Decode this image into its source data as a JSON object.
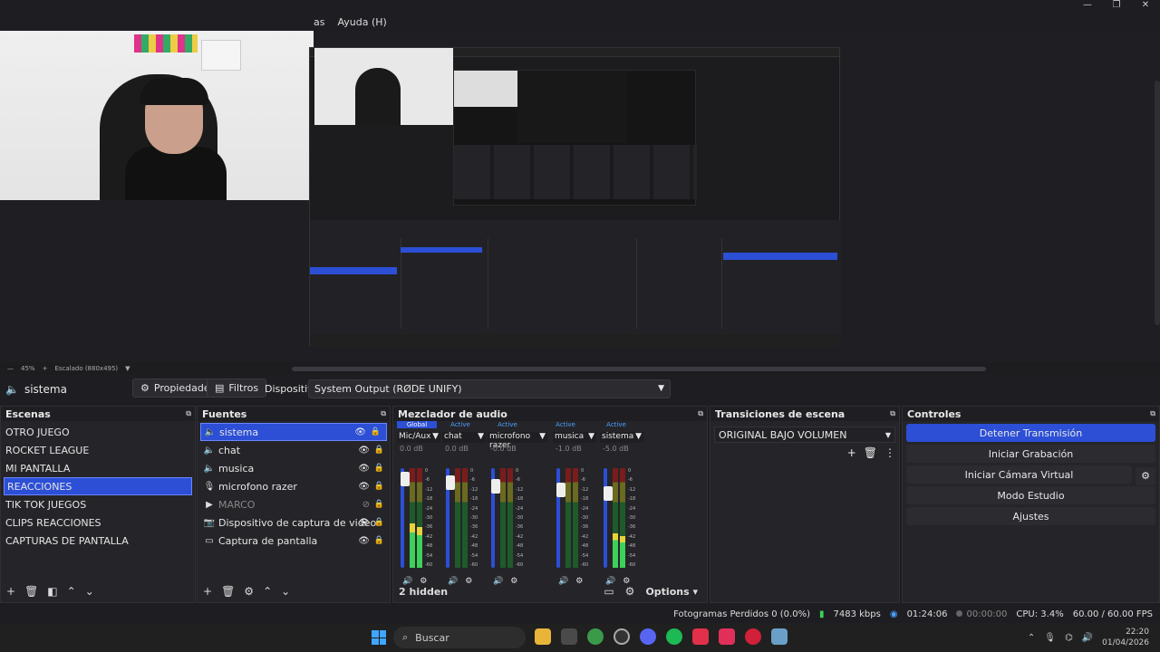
{
  "menu": {
    "partial": "as",
    "help": "Ayuda (H)"
  },
  "zoom": {
    "level": "45%",
    "scale": "Escalado (880x495)"
  },
  "propbar": {
    "source": "sistema",
    "properties": "Propiedades",
    "filters": "Filtros",
    "device_label": "Dispositivo",
    "device_value": "System Output (RØDE UNIFY)"
  },
  "scenes": {
    "title": "Escenas",
    "items": [
      "OTRO JUEGO",
      "ROCKET LEAGUE",
      "MI PANTALLA",
      "REACCIONES",
      "TIK TOK JUEGOS",
      "CLIPS REACCIONES",
      "CAPTURAS DE PANTALLA"
    ],
    "selected": "REACCIONES"
  },
  "sources": {
    "title": "Fuentes",
    "items": [
      {
        "name": "sistema",
        "icon": "speaker-icon"
      },
      {
        "name": "chat",
        "icon": "speaker-icon"
      },
      {
        "name": "musica",
        "icon": "speaker-icon"
      },
      {
        "name": "microfono razer",
        "icon": "microphone-icon"
      },
      {
        "name": "MARCO",
        "icon": "play-icon"
      },
      {
        "name": "Dispositivo de captura de video",
        "icon": "camera-icon"
      },
      {
        "name": "Captura de pantalla",
        "icon": "monitor-icon"
      }
    ]
  },
  "mixer": {
    "title": "Mezclador de audio",
    "tabs": [
      "Global",
      "Active",
      "Active",
      "Active",
      "Active"
    ],
    "hidden": "2 hidden",
    "options": "Options",
    "channels": [
      {
        "name": "Mic/Aux",
        "db": "0.0 dB",
        "level": 0.45
      },
      {
        "name": "chat",
        "db": "0.0 dB",
        "level": 0.0
      },
      {
        "name": "microfono razer",
        "db": "-0.0 dB",
        "level": 0.0
      },
      {
        "name": "musica",
        "db": "-1.0 dB",
        "level": 0.0
      },
      {
        "name": "sistema",
        "db": "-5.0 dB",
        "level": 0.35
      }
    ],
    "scale": [
      "0",
      "-6",
      "-12",
      "-18",
      "-24",
      "-30",
      "-36",
      "-42",
      "-48",
      "-54",
      "-60"
    ]
  },
  "transitions": {
    "title": "Transiciones de escena",
    "selected": "ORIGINAL BAJO VOLUMEN"
  },
  "controls": {
    "title": "Controles",
    "stop_stream": "Detener Transmisión",
    "start_record": "Iniciar Grabación",
    "virtual_cam": "Iniciar Cámara Virtual",
    "studio": "Modo Estudio",
    "settings": "Ajustes"
  },
  "status": {
    "dropped": "Fotogramas Perdidos 0 (0.0%)",
    "kbps": "7483 kbps",
    "stream_time": "01:24:06",
    "rec_time": "00:00:00",
    "cpu": "CPU: 3.4%",
    "fps": "60.00 / 60.00 FPS"
  },
  "taskbar": {
    "search": "Buscar",
    "time": "22:20",
    "date": "01/04/2026"
  },
  "colors": {
    "accent": "#2c4fd6",
    "bg": "#1e1e22"
  }
}
